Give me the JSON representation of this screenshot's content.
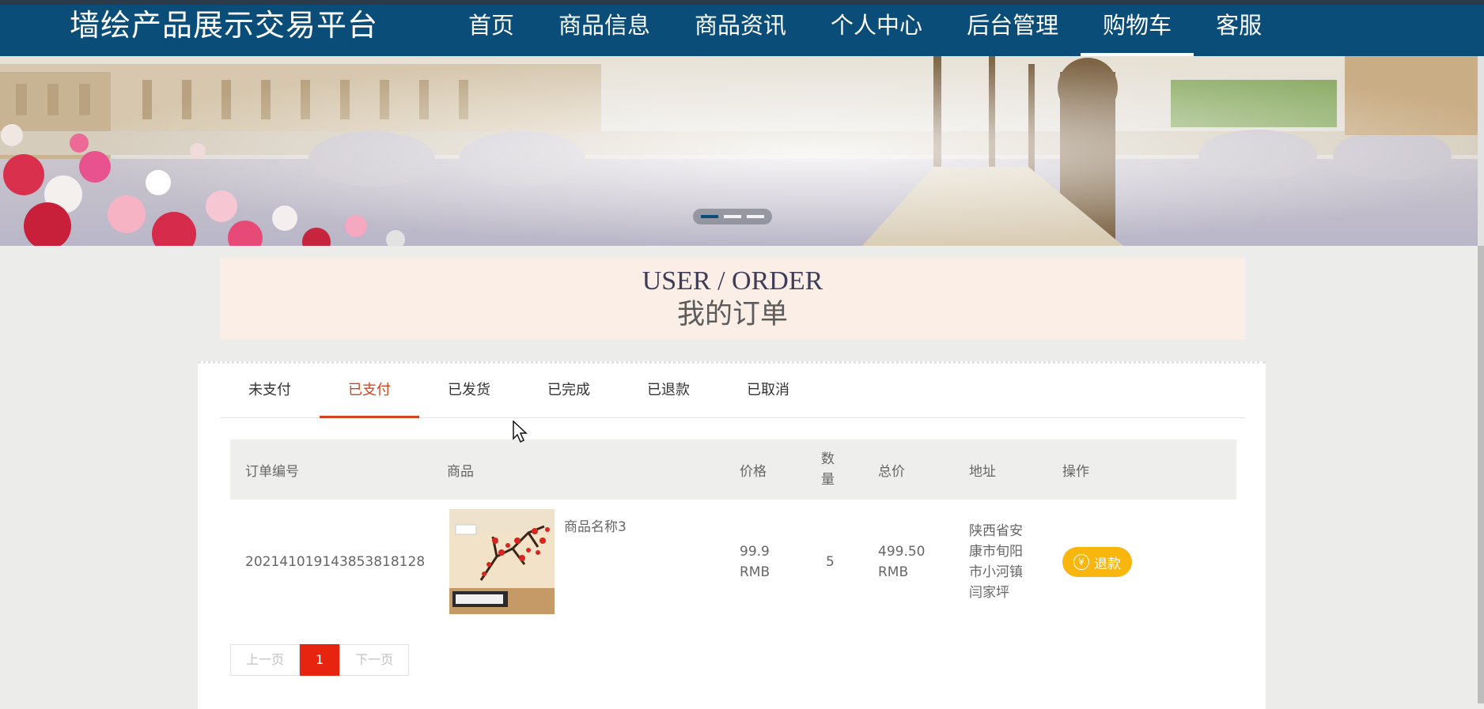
{
  "header": {
    "brand": "墙绘产品展示交易平台",
    "menu": [
      {
        "label": "首页"
      },
      {
        "label": "商品信息"
      },
      {
        "label": "商品资讯"
      },
      {
        "label": "个人中心"
      },
      {
        "label": "后台管理"
      },
      {
        "label": "购物车"
      },
      {
        "label": "客服"
      }
    ],
    "active_menu": "购物车"
  },
  "carousel": {
    "slide_count": 3,
    "active_slide": 1
  },
  "section": {
    "title_en": "USER / ORDER",
    "title_zh": "我的订单"
  },
  "tabs": {
    "items": [
      "未支付",
      "已支付",
      "已发货",
      "已完成",
      "已退款",
      "已取消"
    ],
    "active": "已支付"
  },
  "table": {
    "headers": {
      "order_no": "订单编号",
      "product": "商品",
      "price": "价格",
      "qty_1": "数",
      "qty_2": "量",
      "total": "总价",
      "address": "地址",
      "action": "操作"
    },
    "rows": [
      {
        "order_no": "20214101914385381812 8",
        "product_name": "商品名称3",
        "price_value": "99.9",
        "price_unit": "RMB",
        "qty": "5",
        "total_value": "499.50",
        "total_unit": "RMB",
        "address_lines": [
          "陕西省安",
          "康市旬阳",
          "市小河镇",
          "闫家坪"
        ],
        "action_label": "退款",
        "action_icon": "¥"
      }
    ]
  },
  "pager": {
    "prev": "上一页",
    "current": "1",
    "next": "下一页"
  },
  "colors": {
    "nav": "#0a4d78",
    "active_tab": "#d4441c",
    "refund": "#f8b60f",
    "page_current": "#e6240f"
  }
}
